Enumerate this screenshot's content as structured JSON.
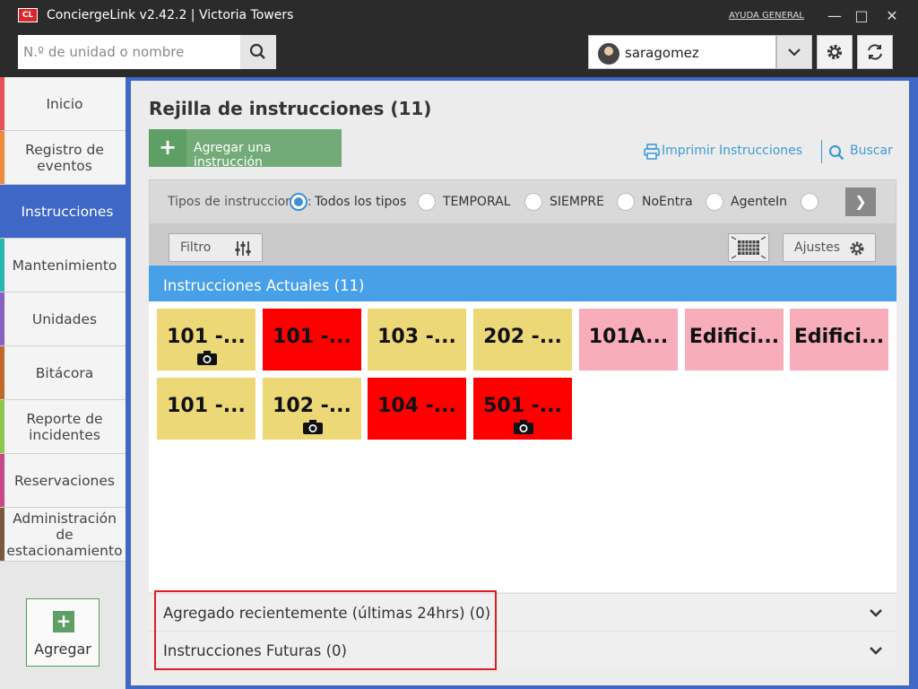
{
  "window": {
    "logo_text": "CL",
    "title": "ConciergeLink v2.42.2 | Victoria Towers",
    "help_link": "AYUDA GENERAL",
    "minimize": "—",
    "maximize": "□",
    "close": "✕"
  },
  "topbar": {
    "search_placeholder": "N.º de unidad o nombre",
    "username": "saragomez"
  },
  "sidebar": {
    "items": [
      {
        "label": "Inicio",
        "color": "#e8515a"
      },
      {
        "label": "Registro de eventos",
        "color": "#f08a3c"
      },
      {
        "label": "Instrucciones",
        "color": "#3f67c6"
      },
      {
        "label": "Mantenimiento",
        "color": "#2bb5b0"
      },
      {
        "label": "Unidades",
        "color": "#8a63c2"
      },
      {
        "label": "Bitácora",
        "color": "#c0692a"
      },
      {
        "label": "Reporte de incidentes",
        "color": "#8dc64a"
      },
      {
        "label": "Reservaciones",
        "color": "#c74a86"
      },
      {
        "label": "Administración de estacionamiento",
        "color": "#7a5a3f"
      }
    ],
    "add_label": "Agregar"
  },
  "main": {
    "title": "Rejilla de instrucciones (11)",
    "add_instruction": "Agregar una instrucción",
    "print_link": "Imprimir Instrucciones",
    "search_link": "Buscar",
    "types_label": "Tipos de instrucciones:",
    "types": [
      {
        "label": "Todos los tipos",
        "selected": true
      },
      {
        "label": "TEMPORAL",
        "selected": false
      },
      {
        "label": "SIEMPRE",
        "selected": false
      },
      {
        "label": "NoEntra",
        "selected": false
      },
      {
        "label": "AgenteIn",
        "selected": false
      }
    ],
    "filter_label": "Filtro",
    "settings_label": "Ajustes",
    "current_header": "Instrucciones Actuales (11)",
    "tiles": [
      {
        "label": "101 -...",
        "color": "yellow",
        "camera": true
      },
      {
        "label": "101 -...",
        "color": "red",
        "camera": false
      },
      {
        "label": "103 -...",
        "color": "yellow",
        "camera": false
      },
      {
        "label": "202 -...",
        "color": "yellow",
        "camera": false
      },
      {
        "label": "101A...",
        "color": "pink",
        "camera": false
      },
      {
        "label": "Edifici...",
        "color": "pink",
        "camera": false
      },
      {
        "label": "Edifici...",
        "color": "pink",
        "camera": false
      },
      {
        "label": "101 -...",
        "color": "yellow",
        "camera": false
      },
      {
        "label": "102 -...",
        "color": "yellow",
        "camera": true
      },
      {
        "label": "104 -...",
        "color": "red",
        "camera": false
      },
      {
        "label": "501 -...",
        "color": "red",
        "camera": true
      }
    ],
    "recent": "Agregado recientemente (últimas 24hrs) (0)",
    "future": "Instrucciones Futuras (0)"
  }
}
